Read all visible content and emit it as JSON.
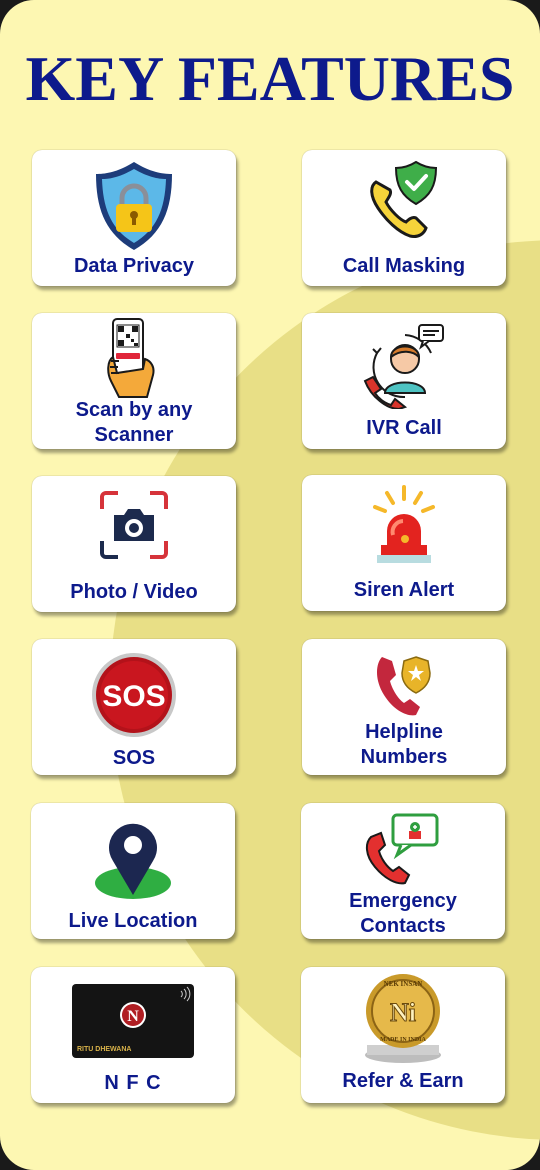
{
  "title": "KEY FEATURES",
  "colors": {
    "background": "#fdf7b2",
    "circle": "#e8df86",
    "title": "#0d1a8c",
    "label": "#0d1a8c"
  },
  "features": [
    {
      "label": "Data Privacy",
      "icon": "shield-lock-icon"
    },
    {
      "label": "Call Masking",
      "icon": "phone-shield-icon"
    },
    {
      "label": "Scan by any\nScanner",
      "icon": "hand-qr-scan-icon"
    },
    {
      "label": "IVR Call",
      "icon": "call-agent-icon"
    },
    {
      "label": "Photo / Video",
      "icon": "camera-frame-icon"
    },
    {
      "label": "Siren Alert",
      "icon": "siren-icon"
    },
    {
      "label": "SOS",
      "icon": "sos-icon"
    },
    {
      "label": "Helpline\nNumbers",
      "icon": "phone-badge-icon"
    },
    {
      "label": "Live Location",
      "icon": "location-pin-icon"
    },
    {
      "label": "Emergency\nContacts",
      "icon": "phone-medical-chat-icon"
    },
    {
      "label": "N F C",
      "icon": "nfc-card-icon",
      "card_text": "RITU DHEWANA",
      "card_logo": "N"
    },
    {
      "label": "Refer & Earn",
      "icon": "coin-icon",
      "coin_top": "NEK INSAN",
      "coin_bottom": "MADE IN INDIA",
      "coin_letter": "Ni"
    }
  ]
}
